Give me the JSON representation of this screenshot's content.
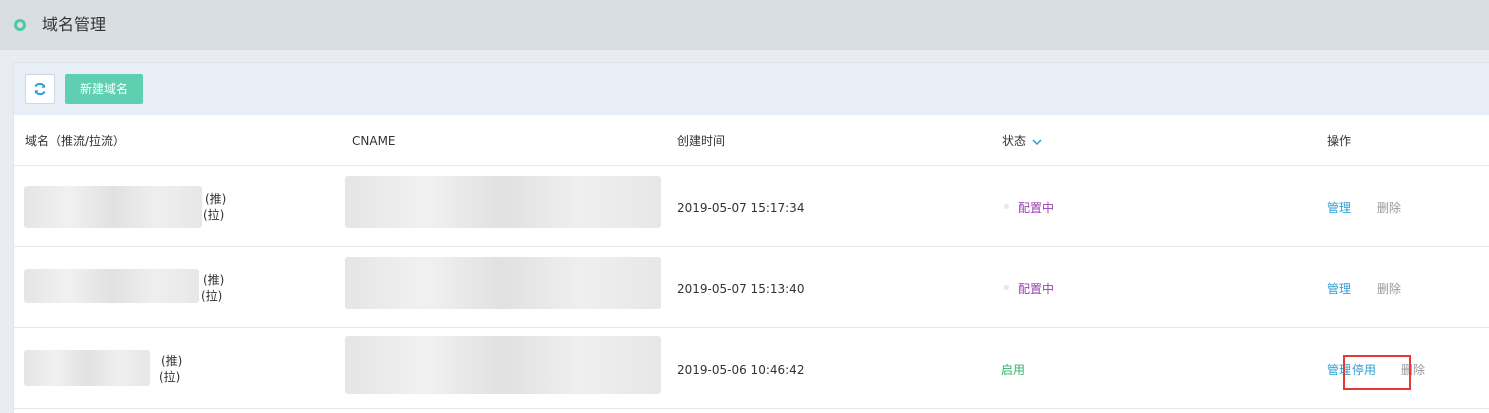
{
  "page": {
    "title": "域名管理"
  },
  "toolbar": {
    "refresh_icon": "refresh-icon",
    "new_button": "新建域名"
  },
  "table": {
    "headers": {
      "domain": "域名（推流/拉流）",
      "cname": "CNAME",
      "created": "创建时间",
      "status": "状态",
      "actions": "操作"
    },
    "rows": [
      {
        "push": "(推)",
        "pull": "(拉)",
        "created": "2019-05-07 15:17:34",
        "status": "配置中",
        "actions": [
          "管理",
          "删除"
        ]
      },
      {
        "push": "(推)",
        "pull": "(拉)",
        "created": "2019-05-07 15:13:40",
        "status": "配置中",
        "actions": [
          "管理",
          "删除"
        ]
      },
      {
        "push": "(推)",
        "pull": "(拉)",
        "created": "2019-05-06 10:46:42",
        "status": "启用",
        "actions": [
          "管理",
          "停用",
          "删除"
        ]
      }
    ]
  },
  "colors": {
    "accent": "#5fcfb2",
    "link": "#2d9fd6",
    "configuring": "#9b3fb0",
    "enabled": "#2fb46b",
    "disabled_text": "#999999",
    "highlight": "#e53935"
  }
}
